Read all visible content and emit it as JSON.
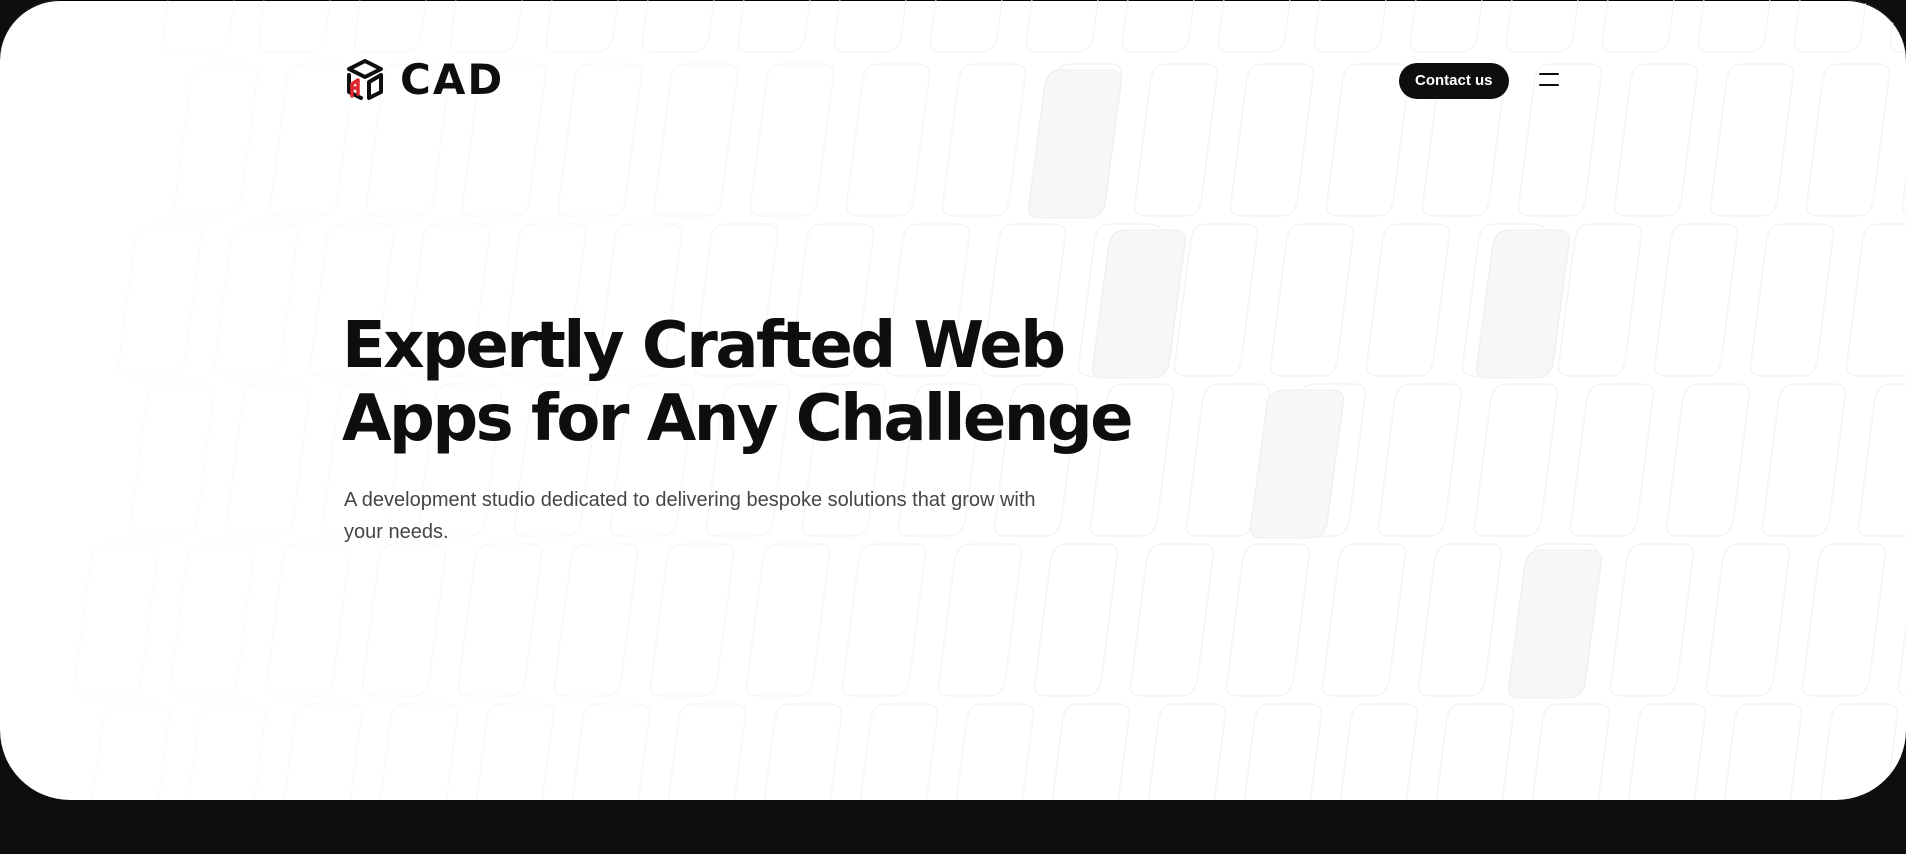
{
  "brand": {
    "name": "CAD",
    "logo_icon": "cube-logo-icon",
    "accent_color": "#e0262d"
  },
  "header": {
    "contact_label": "Contact us",
    "menu_icon": "hamburger-menu-icon"
  },
  "hero": {
    "headline_line1": "Expertly Crafted Web",
    "headline_line2": "Apps for Any Challenge",
    "subtitle_line1": "A development studio dedicated to delivering bespoke solutions that grow with",
    "subtitle_line2": "your needs."
  },
  "colors": {
    "text": "#0e0e0e",
    "background": "#ffffff",
    "footer_band": "#0e0e0e"
  }
}
